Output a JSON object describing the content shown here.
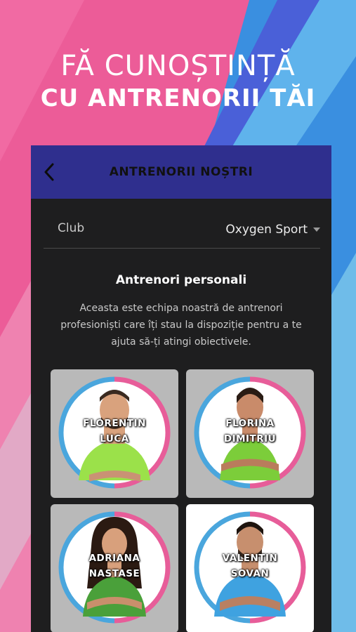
{
  "hero": {
    "line1": "FĂ CUNOȘTINȚĂ",
    "line2": "CU ANTRENORII TĂI"
  },
  "topbar": {
    "title": "ANTRENORII NOȘTRI",
    "back_icon": "chevron-left-icon"
  },
  "club": {
    "label": "Club",
    "selected": "Oxygen Sport"
  },
  "section": {
    "title": "Antrenori personali",
    "description": "Aceasta este echipa noastră de antrenori profesioniști care îți stau la dispoziție pentru a te ajuta să-ți atingi obiectivele."
  },
  "trainers": [
    {
      "first": "FLORENTIN",
      "last": "LUCA"
    },
    {
      "first": "FLORINA",
      "last": "DIMITRIU"
    },
    {
      "first": "ADRIANA",
      "last": "NASTASE"
    },
    {
      "first": "VALENTIN",
      "last": "SOVAN"
    }
  ],
  "colors": {
    "topbar": "#2f2f8e",
    "pink": "#e75d99",
    "blue": "#4aa6dd",
    "panel": "#1e1e1f"
  }
}
